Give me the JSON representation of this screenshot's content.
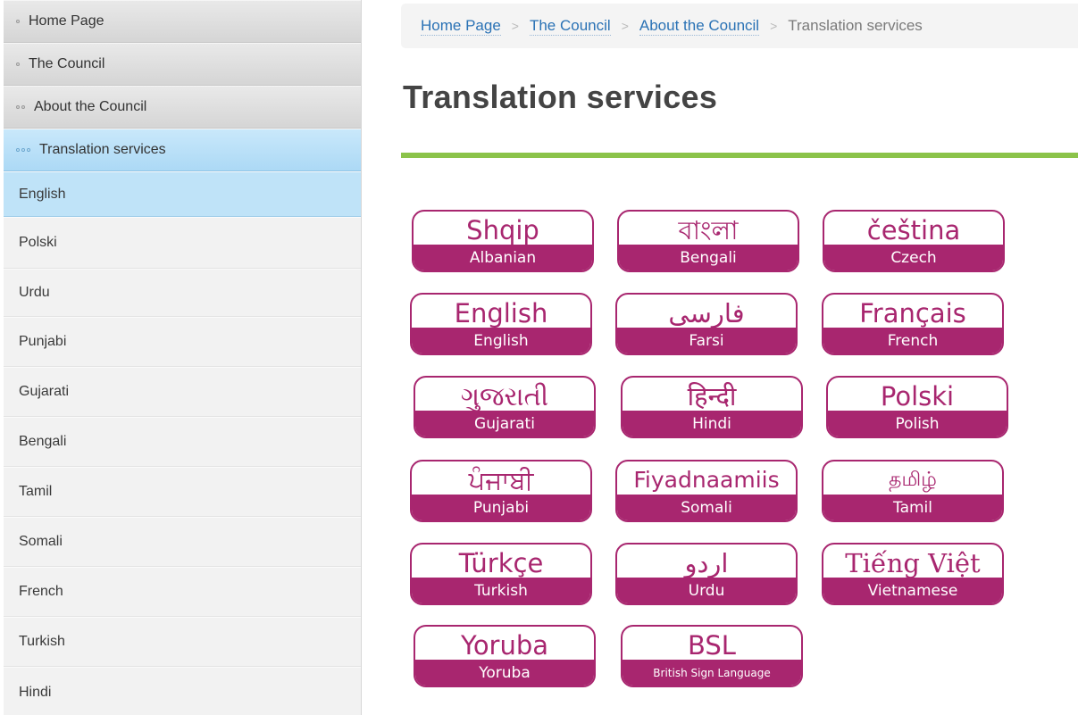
{
  "sidebar": {
    "nav": [
      {
        "label": "Home Page",
        "dots": 1
      },
      {
        "label": "The Council",
        "dots": 1
      },
      {
        "label": "About the Council",
        "dots": 2
      },
      {
        "label": "Translation services",
        "dots": 3
      }
    ],
    "languages": [
      "English",
      "Polski",
      "Urdu",
      "Punjabi",
      "Gujarati",
      "Bengali",
      "Tamil",
      "Somali",
      "French",
      "Turkish",
      "Hindi"
    ]
  },
  "breadcrumb": {
    "items": [
      "Home Page",
      "The Council",
      "About the Council"
    ],
    "current": "Translation services",
    "separator": ">"
  },
  "page": {
    "title": "Translation services"
  },
  "colors": {
    "accent": "#a8266f",
    "rule": "#8bc34a",
    "link": "#2a72b5",
    "active_nav": "#bfe3f8"
  },
  "languages": [
    {
      "native": "Shqip",
      "english": "Albanian"
    },
    {
      "native": "বাংলা",
      "english": "Bengali"
    },
    {
      "native": "čeština",
      "english": "Czech"
    },
    {
      "native": "English",
      "english": "English"
    },
    {
      "native": "فارسی",
      "english": "Farsi"
    },
    {
      "native": "Français",
      "english": "French"
    },
    {
      "native": "ગુજરાતી",
      "english": "Gujarati"
    },
    {
      "native": "हिन्दी",
      "english": "Hindi"
    },
    {
      "native": "Polski",
      "english": "Polish"
    },
    {
      "native": "ਪੰਜਾਬੀ",
      "english": "Punjabi"
    },
    {
      "native": "Fiyadnaamiis",
      "english": "Somali"
    },
    {
      "native": "தமிழ்",
      "english": "Tamil"
    },
    {
      "native": "Türkçe",
      "english": "Turkish"
    },
    {
      "native": "اردو",
      "english": "Urdu"
    },
    {
      "native": "Tiếng Việt",
      "english": "Vietnamese"
    },
    {
      "native": "Yoruba",
      "english": "Yoruba"
    },
    {
      "native": "BSL",
      "english": "British Sign Language"
    }
  ]
}
